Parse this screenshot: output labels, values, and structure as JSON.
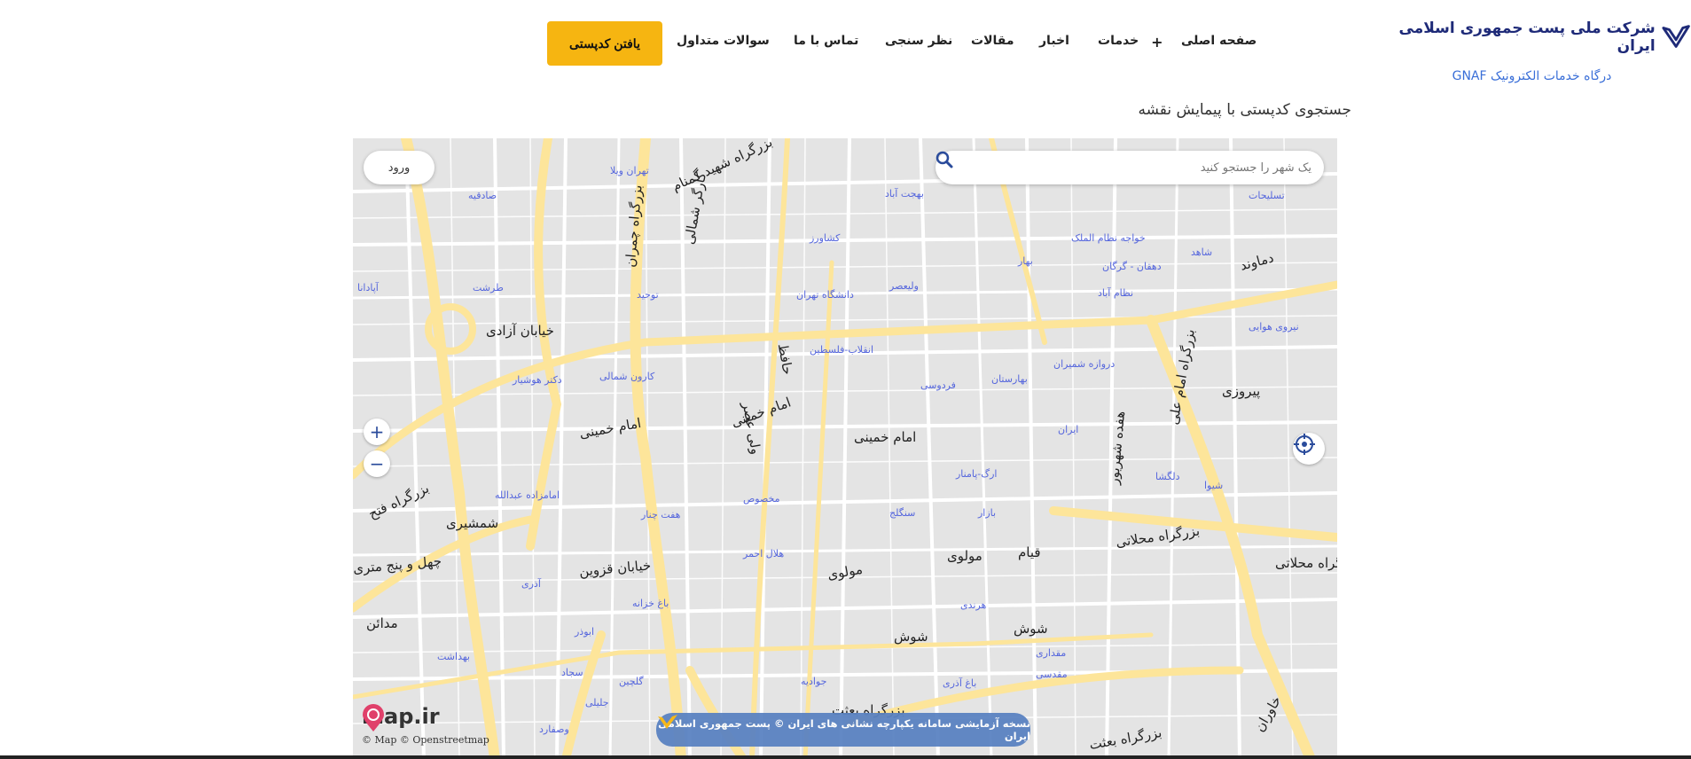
{
  "header": {
    "logo_text": "شرکت ملی پست جمهوری اسلامی ایران",
    "subtitle": "درگاه خدمات الکترونیک GNAF",
    "nav": [
      "صفحه اصلی",
      "خدمات",
      "اخبار",
      "مقالات",
      "نظر سنجی",
      "تماس با ما",
      "سوالات متداول"
    ],
    "services_plus": "+",
    "cta": "یافتن کدپستی",
    "accent": "#f6b511"
  },
  "page": {
    "heading": "جستجوی کدپستی با پیمایش نقشه"
  },
  "map": {
    "login": "ورود",
    "search_placeholder": "یک شهر را جستجو کنید",
    "zoom_in": "+",
    "zoom_out": "−",
    "brand": "map.ir",
    "attribution": "© Map © Openstreetmap",
    "banner": "نسخه آزمایشی سامانه یکپارچه نشانی های ایران © پست جمهوری اسلامی ایران",
    "roads": [
      "بزرگراه شهید گمنام",
      "خیابان آزادی",
      "امام خمینی",
      "امام خمینی",
      "امام خمینی",
      "پیروزی",
      "بزرگراه محلاتی",
      "بزرگراه محلاتی",
      "خیابان قزوین",
      "مولوی",
      "مولوی",
      "قیام",
      "شوش",
      "شوش",
      "بزرگراه بعثت",
      "بزرگراه بعثت",
      "مدائن",
      "چهل و پنج متری",
      "شمشیری",
      "بزرگراه فتح",
      "دماوند",
      "ولی عصر",
      "حافظ",
      "کارگر شمالی",
      "بزرگراه چمران",
      "بزرگراه امام علی",
      "هفده شهریور",
      "خاوران"
    ],
    "places": [
      "تهران ویلا",
      "صادقیه",
      "بهجت آباد",
      "تسلیحات",
      "کشاورز",
      "بهار",
      "خواجه نظام الملک",
      "شاهد",
      "دهقان - گرگان",
      "نظام آباد",
      "آپادانا",
      "طرشت",
      "توحید",
      "دانشگاه تهران",
      "ولیعصر",
      "انقلاب-فلسطین",
      "فردوسی",
      "بهارستان",
      "دروازه شمیران",
      "نیروی هوایی",
      "دکتر هوشیار",
      "کارون شمالی",
      "ارگ-پامنار",
      "مخصوص",
      "هفت چنار",
      "سنگلج",
      "بازار",
      "هلال احمر",
      "امامزاده عبدالله",
      "آذری",
      "باغ خزانه",
      "هرندی",
      "ابوذر",
      "مقدسی",
      "باغ آذری",
      "بهداشت",
      "سجاد",
      "گلچین",
      "جوادیه",
      "جلیلی",
      "وصفارد",
      "مقداری",
      "شیوا",
      "دلگشا",
      "ایران"
    ]
  }
}
